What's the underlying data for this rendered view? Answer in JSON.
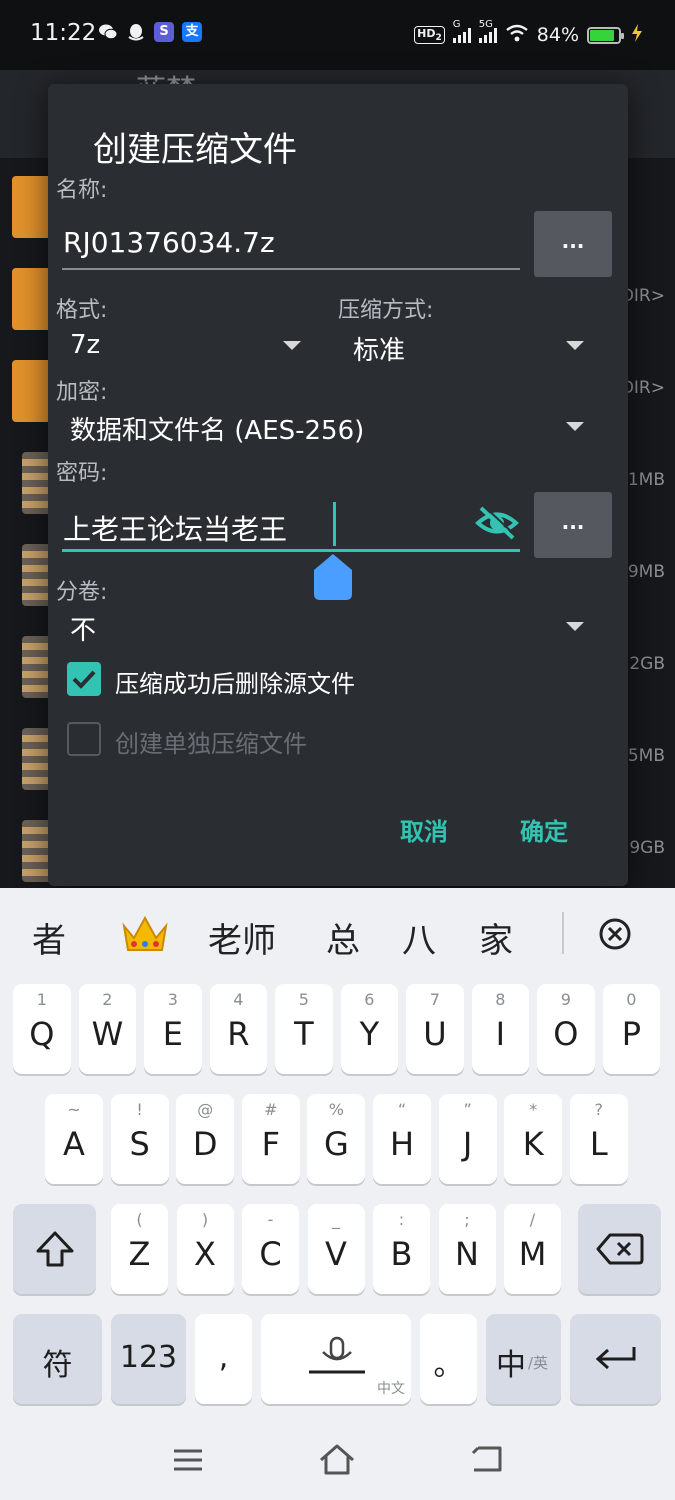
{
  "status_bar": {
    "time": "11:22",
    "app_icons": [
      "wechat-icon",
      "qq-icon",
      "soul-icon",
      "alipay-icon"
    ],
    "hd_label": "HD",
    "hd_sub": "2",
    "sim1_label": "G",
    "sim2_label": "5G",
    "battery_percent": "84%",
    "battery_level": 0.84
  },
  "background_app": {
    "title_partial": "蓝梦",
    "sizes": [
      "DIR>",
      "DIR>",
      "1MB",
      "9MB",
      "2GB",
      "5MB",
      "9GB"
    ]
  },
  "dialog": {
    "title": "创建压缩文件",
    "name_label": "名称:",
    "name_value": "RJ01376034.7z",
    "browse_label": "...",
    "format_label": "格式:",
    "format_value": "7z",
    "method_label": "压缩方式:",
    "method_value": "标准",
    "encryption_label": "加密:",
    "encryption_value": "数据和文件名 (AES-256)",
    "password_label": "密码:",
    "password_value": "上老王论坛当老王",
    "password_more_label": "...",
    "split_label": "分卷:",
    "split_value": "不",
    "delete_source_label": "压缩成功后删除源文件",
    "delete_source_checked": true,
    "separate_archive_label": "创建单独压缩文件",
    "separate_archive_checked": false,
    "cancel_label": "取消",
    "ok_label": "确定"
  },
  "keyboard": {
    "candidates": [
      "者",
      "老师",
      "总",
      "八",
      "家"
    ],
    "candidate_emoji": "crown-emoji",
    "row1": [
      {
        "k": "Q",
        "s": "1"
      },
      {
        "k": "W",
        "s": "2"
      },
      {
        "k": "E",
        "s": "3"
      },
      {
        "k": "R",
        "s": "4"
      },
      {
        "k": "T",
        "s": "5"
      },
      {
        "k": "Y",
        "s": "6"
      },
      {
        "k": "U",
        "s": "7"
      },
      {
        "k": "I",
        "s": "8"
      },
      {
        "k": "O",
        "s": "9"
      },
      {
        "k": "P",
        "s": "0"
      }
    ],
    "row2": [
      {
        "k": "A",
        "s": "~"
      },
      {
        "k": "S",
        "s": "!"
      },
      {
        "k": "D",
        "s": "@"
      },
      {
        "k": "F",
        "s": "#"
      },
      {
        "k": "G",
        "s": "%"
      },
      {
        "k": "H",
        "s": "“"
      },
      {
        "k": "J",
        "s": "”"
      },
      {
        "k": "K",
        "s": "*"
      },
      {
        "k": "L",
        "s": "?"
      }
    ],
    "row3": [
      {
        "k": "Z",
        "s": "("
      },
      {
        "k": "X",
        "s": ")"
      },
      {
        "k": "C",
        "s": "-"
      },
      {
        "k": "V",
        "s": "_"
      },
      {
        "k": "B",
        "s": ":"
      },
      {
        "k": "N",
        "s": ";"
      },
      {
        "k": "M",
        "s": "/"
      }
    ],
    "symbol_label": "符",
    "numbers_label": "123",
    "comma_label": ",",
    "space_label": "中文",
    "period_label": "。",
    "lang_label": "中",
    "lang_sub": "/英"
  },
  "colors": {
    "accent": "#33c3b3",
    "dialog_bg": "#2a2d31",
    "handle": "#4a9eff"
  }
}
